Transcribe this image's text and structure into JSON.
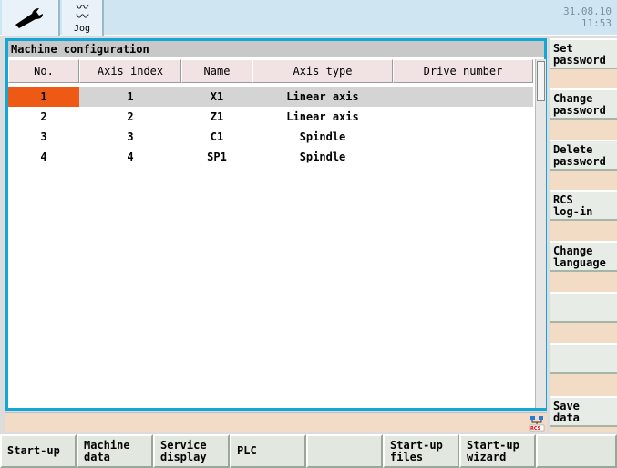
{
  "topbar": {
    "mode_label": "Jog",
    "date": "31.08.10",
    "time": "11:53"
  },
  "panel": {
    "title": "Machine configuration",
    "columns": [
      "No.",
      "Axis index",
      "Name",
      "Axis type",
      "Drive number"
    ],
    "rows": [
      {
        "no": "1",
        "axis_index": "1",
        "name": "X1",
        "axis_type": "Linear axis",
        "drive_number": ""
      },
      {
        "no": "2",
        "axis_index": "2",
        "name": "Z1",
        "axis_type": "Linear axis",
        "drive_number": ""
      },
      {
        "no": "3",
        "axis_index": "3",
        "name": "C1",
        "axis_type": "Spindle",
        "drive_number": ""
      },
      {
        "no": "4",
        "axis_index": "4",
        "name": "SP1",
        "axis_type": "Spindle",
        "drive_number": ""
      }
    ],
    "selected_row": 0
  },
  "vertical_softkeys": [
    {
      "line1": "Set",
      "line2": "password"
    },
    {
      "line1": "Change",
      "line2": "password"
    },
    {
      "line1": "Delete",
      "line2": "password"
    },
    {
      "line1": "RCS",
      "line2": "log-in"
    },
    {
      "line1": "Change",
      "line2": "language"
    },
    {
      "line1": "",
      "line2": ""
    },
    {
      "line1": "",
      "line2": ""
    },
    {
      "line1": "Save",
      "line2": "data"
    }
  ],
  "horizontal_softkeys": [
    {
      "label": "Start-up"
    },
    {
      "label": "Machine\ndata"
    },
    {
      "label": "Service\ndisplay"
    },
    {
      "label": "PLC"
    },
    {
      "label": ""
    },
    {
      "label": "Start-up\nfiles"
    },
    {
      "label": "Start-up\nwizard"
    },
    {
      "label": ""
    }
  ],
  "colors": {
    "accent": "#14a7d6",
    "selection": "#ee5a16",
    "softkey_bg": "#e8ece7"
  }
}
